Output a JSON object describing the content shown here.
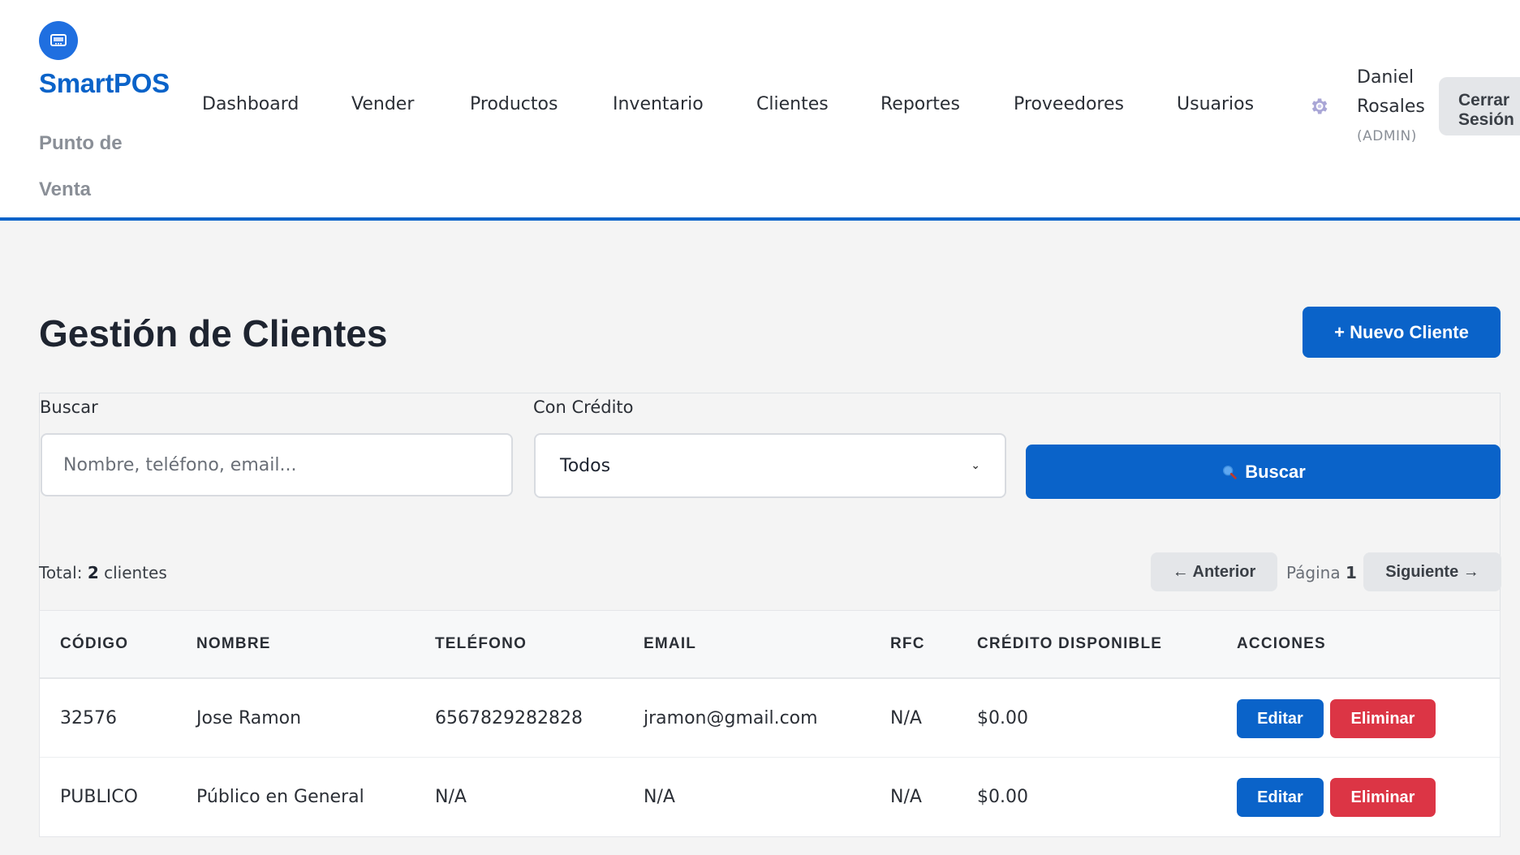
{
  "brand": {
    "name": "SmartPOS",
    "subtitle": "Punto de Venta"
  },
  "nav": [
    {
      "label": "Dashboard"
    },
    {
      "label": "Vender"
    },
    {
      "label": "Productos"
    },
    {
      "label": "Inventario"
    },
    {
      "label": "Clientes"
    },
    {
      "label": "Reportes"
    },
    {
      "label": "Proveedores"
    },
    {
      "label": "Usuarios"
    }
  ],
  "user": {
    "name": "Daniel Rosales",
    "role": "(ADMIN)",
    "logout_label": "Cerrar Sesión"
  },
  "page": {
    "title": "Gestión de Clientes",
    "new_button": "+ Nuevo Cliente"
  },
  "filters": {
    "search_label": "Buscar",
    "search_placeholder": "Nombre, teléfono, email...",
    "search_value": "",
    "credit_label": "Con Crédito",
    "credit_selected": "Todos",
    "search_button": "Buscar"
  },
  "summary": {
    "total_prefix": "Total:",
    "total_count": "2",
    "total_suffix": "clientes"
  },
  "pagination": {
    "prev_label": "← Anterior",
    "page_label": "Página",
    "page_number": "1",
    "next_label": "Siguiente →"
  },
  "table": {
    "headers": [
      "CÓDIGO",
      "NOMBRE",
      "TELÉFONO",
      "EMAIL",
      "RFC",
      "CRÉDITO DISPONIBLE",
      "ACCIONES"
    ],
    "rows": [
      {
        "codigo": "32576",
        "nombre": "Jose Ramon",
        "telefono": "6567829282828",
        "email": "jramon@gmail.com",
        "rfc": "N/A",
        "credito": "$0.00"
      },
      {
        "codigo": "PUBLICO",
        "nombre": "Público en General",
        "telefono": "N/A",
        "email": "N/A",
        "rfc": "N/A",
        "credito": "$0.00"
      }
    ],
    "edit_label": "Editar",
    "delete_label": "Eliminar"
  },
  "colors": {
    "primary": "#0a63c9",
    "danger": "#dc3545",
    "muted": "#8a8f97"
  },
  "icons": {
    "logo": "pos-terminal-icon",
    "settings": "gear-icon",
    "search": "magnifier-icon",
    "select": "chevron-down-icon"
  }
}
